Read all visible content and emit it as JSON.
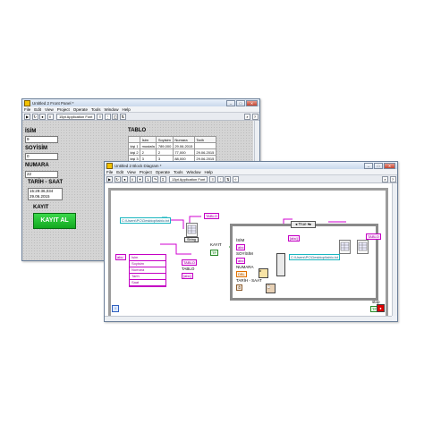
{
  "front_panel": {
    "title": "Untitled 2 Front Panel *",
    "menu": [
      "File",
      "Edit",
      "View",
      "Project",
      "Operate",
      "Tools",
      "Window",
      "Help"
    ],
    "font": "15pt Application Font",
    "labels": {
      "isim": "İSİM",
      "soyisim": "SOYİSİM",
      "numara": "NUMARA",
      "tarih": "TARİH - SAAT",
      "kayit": "KAYIT",
      "tablo": "TABLO"
    },
    "values": {
      "isim": "9",
      "soyisim": "0",
      "numara": "22",
      "tarih_line1": "15:29:36,034",
      "tarih_line2": "29.06.2015"
    },
    "button_label": "KAYIT AL",
    "table": {
      "headers": [
        "",
        "İsim",
        "Soyisim",
        "Numara",
        "Tarih"
      ],
      "rows": [
        [
          "kişi 1",
          "mustafa",
          "789,000",
          "29.06.2015",
          ""
        ],
        [
          "kişi 2",
          "2",
          "2",
          "77,000",
          "29.06.2015"
        ],
        [
          "kişi 3",
          "3",
          "3",
          "88,000",
          "29.06.2015"
        ],
        [
          "kişi 4",
          "4",
          "4",
          "99,000",
          "29.06.2015"
        ],
        [
          "kişi 5",
          "5",
          "5",
          "",
          "29.06.2015"
        ]
      ]
    }
  },
  "block_diagram": {
    "title": "Untitled 2 Block Diagram *",
    "menu": [
      "File",
      "Edit",
      "View",
      "Project",
      "Operate",
      "Tools",
      "Window",
      "Help"
    ],
    "font": "13pt Application Font",
    "path1": "C:\\Users\\PC\\Desktop\\tablo.txt",
    "path2": "C:\\Users\\PC\\Desktop\\tablo.txt",
    "tablo_term": "TABLO",
    "tablo_term2": "TABLO",
    "tablo_label": "TABLO",
    "string_node": "String",
    "bundle_items": [
      "İsim",
      "Soyisim",
      "Numara",
      "Tarih",
      "Saat"
    ],
    "case_selector": "True",
    "kayit_label": "KAYIT",
    "kayit_term": "TF",
    "inner_labels": {
      "isim": "İSİM",
      "soyisim": "SOYİSİM",
      "numara": "NUMARA",
      "tarih": "TARİH - SAAT"
    },
    "stop_label": "stop",
    "stop_term": "TF",
    "iter": "i"
  }
}
